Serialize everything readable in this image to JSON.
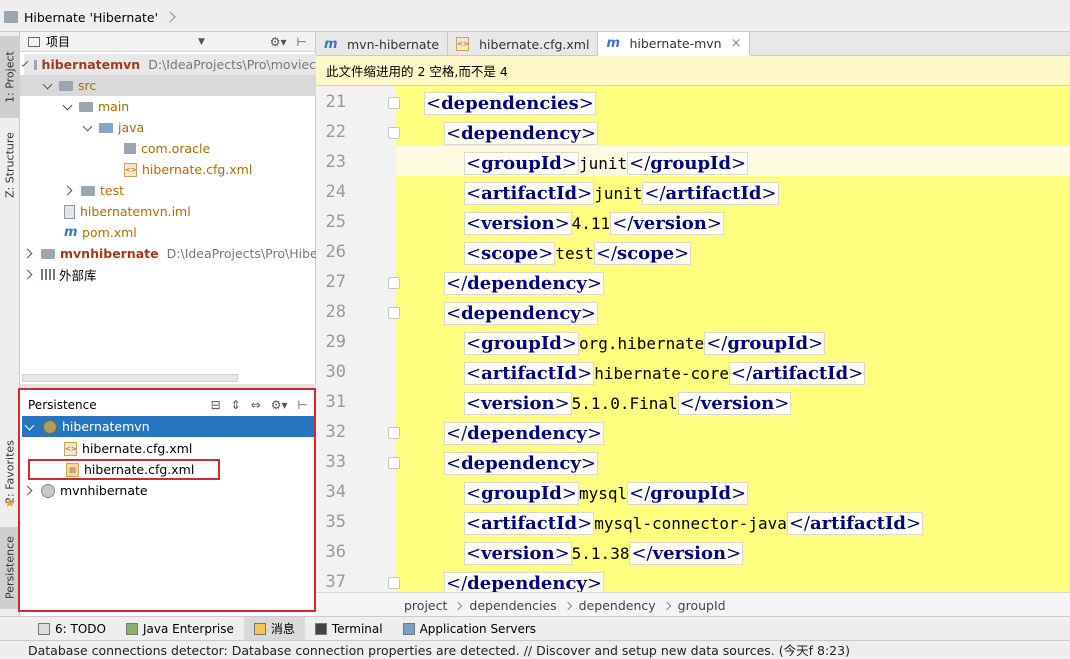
{
  "window": {
    "title": "Hibernate 'Hibernate'"
  },
  "leftstrip": {
    "project": "1: Project",
    "structure": "Z: Structure",
    "favorites": "2: Favorites",
    "persistence": "Persistence"
  },
  "project_panel": {
    "header": "项目",
    "items": [
      {
        "label": "hibernatemvn",
        "path": "D:\\IdeaProjects\\Pro\\moviec"
      },
      {
        "label": "src"
      },
      {
        "label": "main"
      },
      {
        "label": "java"
      },
      {
        "label": "com.oracle"
      },
      {
        "label": "hibernate.cfg.xml"
      },
      {
        "label": "test"
      },
      {
        "label": "hibernatemvn.iml"
      },
      {
        "label": "pom.xml"
      },
      {
        "label": "mvnhibernate",
        "path": "D:\\IdeaProjects\\Pro\\Hiberna"
      },
      {
        "label": "外部库"
      }
    ]
  },
  "persistence_panel": {
    "header": "Persistence",
    "items": [
      {
        "label": "hibernatemvn"
      },
      {
        "label": "hibernate.cfg.xml"
      },
      {
        "label": "hibernate.cfg.xml"
      },
      {
        "label": "mvnhibernate"
      }
    ]
  },
  "editor_tabs": [
    {
      "label": "mvn-hibernate"
    },
    {
      "label": "hibernate.cfg.xml"
    },
    {
      "label": "hibernate-mvn"
    }
  ],
  "notice": "此文件缩进用的 2 空格,而不是 4",
  "code": {
    "line_numbers": [
      "21",
      "22",
      "23",
      "24",
      "25",
      "26",
      "27",
      "28",
      "29",
      "30",
      "31",
      "32",
      "33",
      "34",
      "35",
      "36",
      "37"
    ],
    "lines": [
      {
        "indent": 0,
        "open": "dependencies"
      },
      {
        "indent": 1,
        "open": "dependency"
      },
      {
        "indent": 2,
        "open": "groupId",
        "text": "junit",
        "close": "groupId"
      },
      {
        "indent": 2,
        "open": "artifactId",
        "text": "junit",
        "close": "artifactId"
      },
      {
        "indent": 2,
        "open": "version",
        "text": "4.11",
        "close": "version"
      },
      {
        "indent": 2,
        "open": "scope",
        "text": "test",
        "close": "scope"
      },
      {
        "indent": 1,
        "close": "dependency"
      },
      {
        "indent": 1,
        "open": "dependency"
      },
      {
        "indent": 2,
        "open": "groupId",
        "text": "org.hibernate",
        "close": "groupId"
      },
      {
        "indent": 2,
        "open": "artifactId",
        "text": "hibernate-core",
        "close": "artifactId"
      },
      {
        "indent": 2,
        "open": "version",
        "text": "5.1.0.Final",
        "close": "version"
      },
      {
        "indent": 1,
        "close": "dependency"
      },
      {
        "indent": 1,
        "open": "dependency"
      },
      {
        "indent": 2,
        "open": "groupId",
        "text": "mysql",
        "close": "groupId"
      },
      {
        "indent": 2,
        "open": "artifactId",
        "text": "mysql-connector-java",
        "close": "artifactId"
      },
      {
        "indent": 2,
        "open": "version",
        "text": "5.1.38",
        "close": "version"
      },
      {
        "indent": 1,
        "close": "dependency"
      }
    ]
  },
  "editor_breadcrumb": [
    "project",
    "dependencies",
    "dependency",
    "groupId"
  ],
  "bottom_tabs": [
    {
      "label": "6: TODO"
    },
    {
      "label": "Java Enterprise"
    },
    {
      "label": "消息"
    },
    {
      "label": "Terminal"
    },
    {
      "label": "Application Servers"
    }
  ],
  "status": "Database connections detector: Database connection properties are detected. // Discover and setup new data sources. (今天f 8:23)"
}
